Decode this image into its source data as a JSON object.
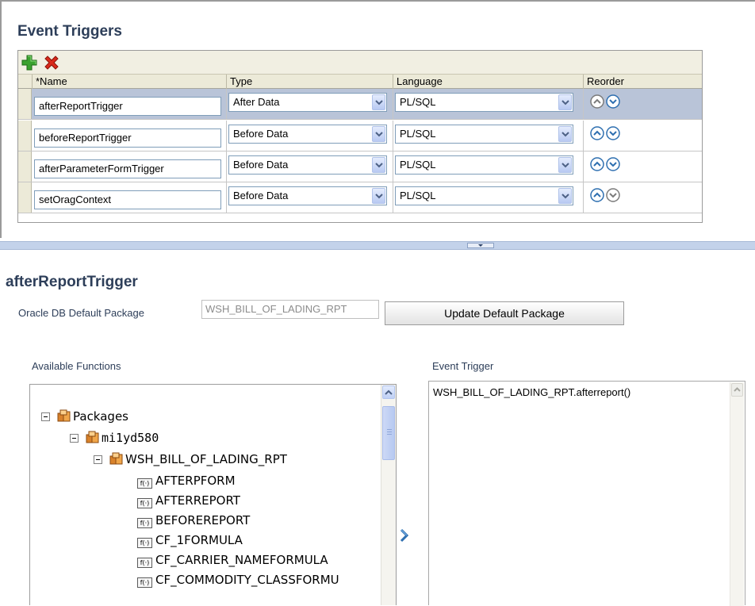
{
  "event_triggers": {
    "title": "Event Triggers",
    "toolbar": {
      "add_icon": "plus-icon",
      "delete_icon": "red-x-icon"
    },
    "columns": {
      "name": "*Name",
      "type": "Type",
      "language": "Language",
      "reorder": "Reorder"
    },
    "rows": [
      {
        "name": "afterReportTrigger",
        "type": "After Data",
        "language": "PL/SQL",
        "selected": true
      },
      {
        "name": "beforeReportTrigger",
        "type": "Before Data",
        "language": "PL/SQL",
        "selected": false
      },
      {
        "name": "afterParameterFormTrigger",
        "type": "Before Data",
        "language": "PL/SQL",
        "selected": false
      },
      {
        "name": "setOragContext",
        "type": "Before Data",
        "language": "PL/SQL",
        "selected": false
      }
    ]
  },
  "detail": {
    "title": "afterReportTrigger",
    "package_label": "Oracle DB Default Package",
    "package_value": "WSH_BILL_OF_LADING_RPT",
    "update_button": "Update Default Package",
    "available_label": "Available Functions",
    "event_trigger_label": "Event Trigger",
    "event_trigger_value": "WSH_BILL_OF_LADING_RPT.afterreport()",
    "tree": {
      "packages": "Packages",
      "schema": "mi1yd580",
      "package": "WSH_BILL_OF_LADING_RPT",
      "fn_icon_text": "f(·)",
      "functions": [
        "AFTERPFORM",
        "AFTERREPORT",
        "BEFOREREPORT",
        "CF_1FORMULA",
        "CF_CARRIER_NAMEFORMULA",
        "CF_COMMODITY_CLASSFORMU"
      ]
    }
  },
  "colors": {
    "title": "#2d3e59",
    "selected_row": "#b9c4d8",
    "toolbar_bg": "#f1efe2",
    "splitter": "#c3d2ea"
  }
}
